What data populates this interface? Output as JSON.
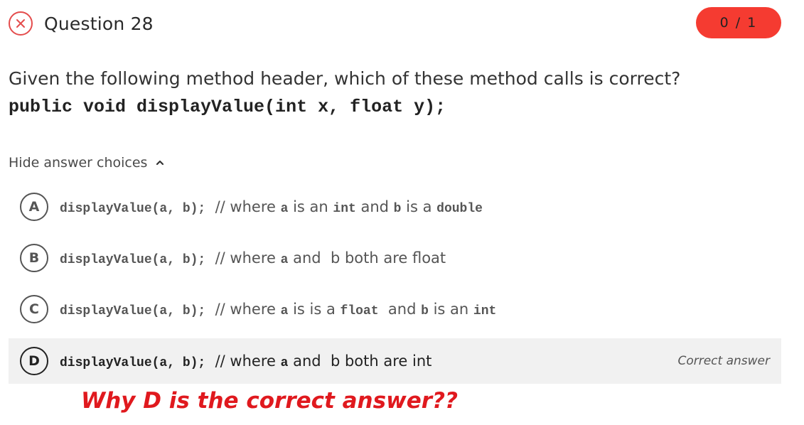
{
  "question": {
    "status_icon": "x-circle-icon",
    "status": "incorrect",
    "title": "Question 28",
    "score": "0 / 1",
    "prompt": "Given the following method header, which of these method calls is correct?",
    "code": "public void displayValue(int x, float y);"
  },
  "toggle": {
    "label": "Hide answer choices",
    "icon": "chevron-up-icon"
  },
  "choices": [
    {
      "letter": "A",
      "parts": [
        {
          "t": "displayValue(a, b);",
          "mono": true
        },
        {
          "t": "  // where ",
          "mono": false
        },
        {
          "t": "a",
          "mono": true
        },
        {
          "t": " is an ",
          "mono": false
        },
        {
          "t": "int",
          "mono": true
        },
        {
          "t": " and ",
          "mono": false
        },
        {
          "t": "b",
          "mono": true
        },
        {
          "t": " is a ",
          "mono": false
        },
        {
          "t": "double",
          "mono": true
        }
      ]
    },
    {
      "letter": "B",
      "parts": [
        {
          "t": "displayValue(a, b);",
          "mono": true
        },
        {
          "t": "  // where ",
          "mono": false
        },
        {
          "t": "a",
          "mono": true
        },
        {
          "t": " and  b both are float",
          "mono": false
        }
      ]
    },
    {
      "letter": "C",
      "parts": [
        {
          "t": "displayValue(a, b);",
          "mono": true
        },
        {
          "t": "  // where ",
          "mono": false
        },
        {
          "t": "a",
          "mono": true
        },
        {
          "t": " is is a ",
          "mono": false
        },
        {
          "t": "float",
          "mono": true
        },
        {
          "t": "  and ",
          "mono": false
        },
        {
          "t": "b",
          "mono": true
        },
        {
          "t": " is an ",
          "mono": false
        },
        {
          "t": "int",
          "mono": true
        }
      ]
    },
    {
      "letter": "D",
      "selected": true,
      "parts": [
        {
          "t": "displayValue(a, b);",
          "mono": true
        },
        {
          "t": "  // where ",
          "mono": false
        },
        {
          "t": "a",
          "mono": true
        },
        {
          "t": " and  b both are int",
          "mono": false
        }
      ],
      "correct_label": "Correct answer"
    }
  ],
  "annotation": "Why D is the correct answer??",
  "colors": {
    "error_red": "#f53b31",
    "annotation_red": "#e0191e",
    "selected_bg": "#f1f1f1"
  }
}
